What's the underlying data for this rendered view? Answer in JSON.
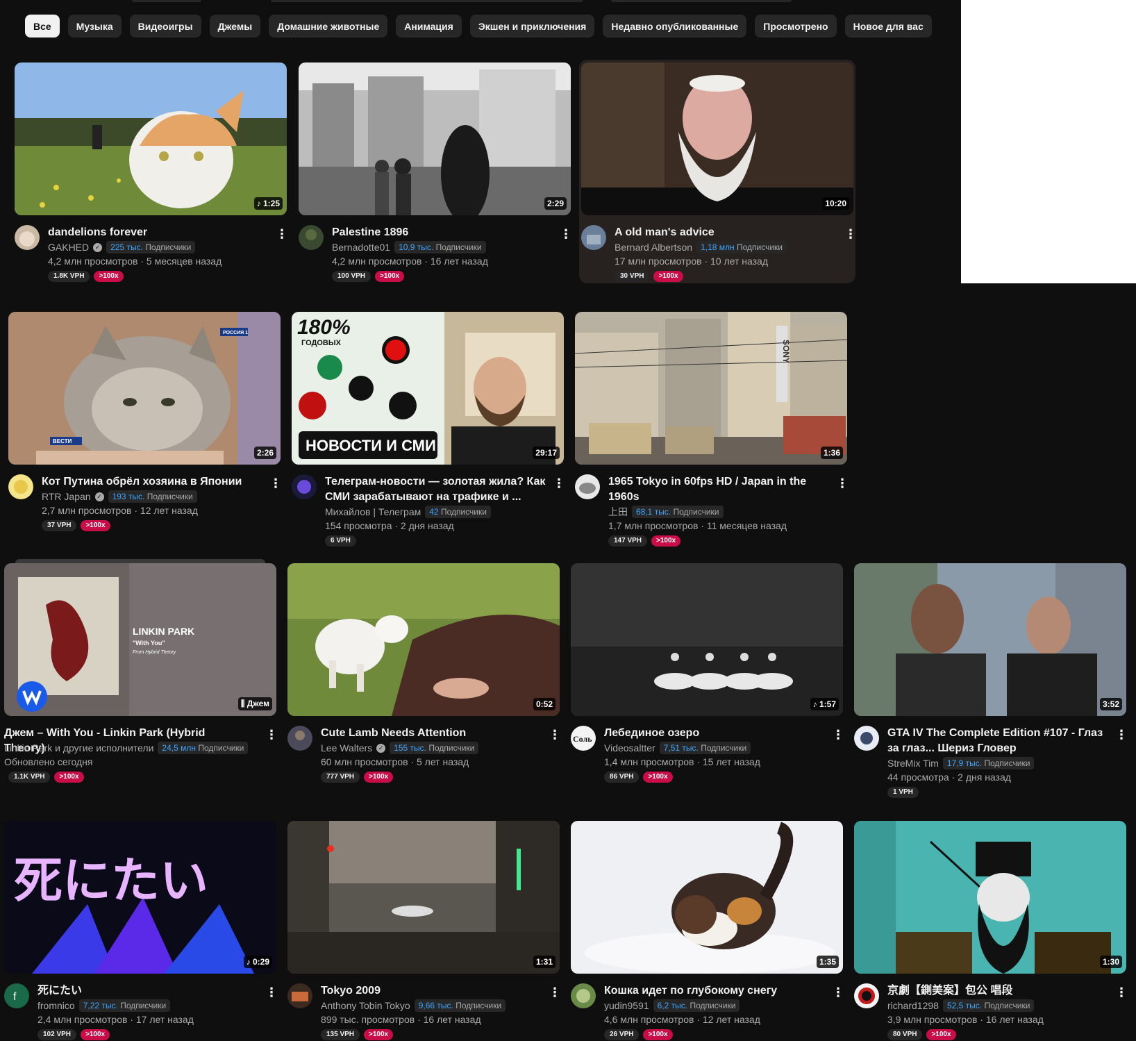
{
  "chips": [
    "Все",
    "Музыка",
    "Видеоигры",
    "Джемы",
    "Домашние животные",
    "Анимация",
    "Экшен и приключения",
    "Недавно опубликованные",
    "Просмотрено",
    "Новое для вас"
  ],
  "videos": [
    {
      "title": "dandelions forever",
      "duration": "♪ 1:25",
      "channel": "GAKHED",
      "verified": true,
      "subs_num": "225 тыс.",
      "subs_label": "Подписчики",
      "stats": "4,2 млн просмотров · 5 месяцев назад",
      "vph": "1.8K VPH",
      "mult": ">100x"
    },
    {
      "title": "Palestine 1896",
      "duration": "2:29",
      "channel": "Bernadotte01",
      "verified": false,
      "subs_num": "10,9 тыс.",
      "subs_label": "Подписчики",
      "stats": "4,2 млн просмотров · 16 лет назад",
      "vph": "100 VPH",
      "mult": ">100x"
    },
    {
      "title": "A old man's advice",
      "duration": "10:20",
      "channel": "Bernard Albertson",
      "verified": false,
      "subs_num": "1,18 млн",
      "subs_label": "Подписчики",
      "stats": "17 млн просмотров · 10 лет назад",
      "vph": "30 VPH",
      "mult": ">100x"
    },
    {
      "title": "Кот Путина обрёл хозяина в Японии",
      "duration": "2:26",
      "channel": "RTR Japan",
      "verified": true,
      "subs_num": "193 тыс.",
      "subs_label": "Подписчики",
      "stats": "2,7 млн просмотров · 12 лет назад",
      "vph": "37 VPH",
      "mult": ">100x"
    },
    {
      "title": "Телеграм-новости — золотая жила? Как СМИ зарабатывают на трафике и ...",
      "duration": "29:17",
      "channel": "Михайлов | Телеграм",
      "verified": false,
      "subs_num": "42",
      "subs_label": "Подписчики",
      "stats": "154 просмотра · 2 дня назад",
      "vph": "6 VPH",
      "mult": ""
    },
    {
      "title": "1965 Tokyo in 60fps HD / Japan in the 1960s",
      "duration": "1:36",
      "channel": "上田",
      "verified": false,
      "subs_num": "68,1 тыс.",
      "subs_label": "Подписчики",
      "stats": "1,7 млн просмотров · 11 месяцев назад",
      "vph": "147 VPH",
      "mult": ">100x"
    },
    {
      "title": "Джем – With You - Linkin Park (Hybrid Theory)",
      "duration": "Джем",
      "channel": "Linkin Park и другие исполнители",
      "verified": false,
      "subs_num": "24,5 млн",
      "subs_label": "Подписчики",
      "stats": "Обновлено сегодня",
      "vph": "1.1K VPH",
      "mult": ">100x"
    },
    {
      "title": "Cute Lamb Needs Attention",
      "duration": "0:52",
      "channel": "Lee Walters",
      "verified": true,
      "subs_num": "155 тыс.",
      "subs_label": "Подписчики",
      "stats": "60 млн просмотров · 5 лет назад",
      "vph": "777 VPH",
      "mult": ">100x"
    },
    {
      "title": "Лебединое озеро",
      "duration": "♪ 1:57",
      "channel": "Videosaltter",
      "verified": false,
      "subs_num": "7,51 тыс.",
      "subs_label": "Подписчики",
      "stats": "1,4 млн просмотров · 15 лет назад",
      "vph": "86 VPH",
      "mult": ">100x"
    },
    {
      "title": "GTA IV The Complete Edition #107 - Глаз за глаз... Шериз Гловер",
      "duration": "3:52",
      "channel": "StreMix Tim",
      "verified": false,
      "subs_num": "17,9 тыс.",
      "subs_label": "Подписчики",
      "stats": "44 просмотра · 2 дня назад",
      "vph": "1 VPH",
      "mult": ""
    },
    {
      "title": "死にたい",
      "duration": "♪ 0:29",
      "channel": "fromnico",
      "verified": false,
      "subs_num": "7,22 тыс.",
      "subs_label": "Подписчики",
      "stats": "2,4 млн просмотров · 17 лет назад",
      "vph": "102 VPH",
      "mult": ">100x"
    },
    {
      "title": "Tokyo 2009",
      "duration": "1:31",
      "channel": "Anthony Tobin Tokyo",
      "verified": false,
      "subs_num": "9,66 тыс.",
      "subs_label": "Подписчики",
      "stats": "899 тыс. просмотров · 16 лет назад",
      "vph": "135 VPH",
      "mult": ">100x"
    },
    {
      "title": "Кошка идет по глубокому снегу",
      "duration": "1:35",
      "channel": "yudin9591",
      "verified": false,
      "subs_num": "6,2 тыс.",
      "subs_label": "Подписчики",
      "stats": "4,6 млн просмотров · 12 лет назад",
      "vph": "26 VPH",
      "mult": ">100x"
    },
    {
      "title": "京劇【鍘美案】包公 唱段",
      "duration": "1:30",
      "channel": "richard1298",
      "verified": false,
      "subs_num": "52,5 тыс.",
      "subs_label": "Подписчики",
      "stats": "3,9 млн просмотров · 16 лет назад",
      "vph": "80 VPH",
      "mult": ">100x"
    }
  ],
  "thumb_text": {
    "news_big": "180%",
    "news_sub": "ГОДОВЫХ",
    "news_banner": "НОВОСТИ И СМИ",
    "lp_title": "LINKIN PARK",
    "lp_sub": "\"With You\"",
    "lp_from": "From Hybrid Theory",
    "rossiya": "РОССИЯ 1",
    "vesti": "ВЕСТИ",
    "sony": "SONY",
    "shini": "死にたい"
  },
  "colors": {
    "accent_blue": "#3ea6ff",
    "badge_red": "#c80d48",
    "bg": "#0f0f0f",
    "chip": "#272727"
  }
}
